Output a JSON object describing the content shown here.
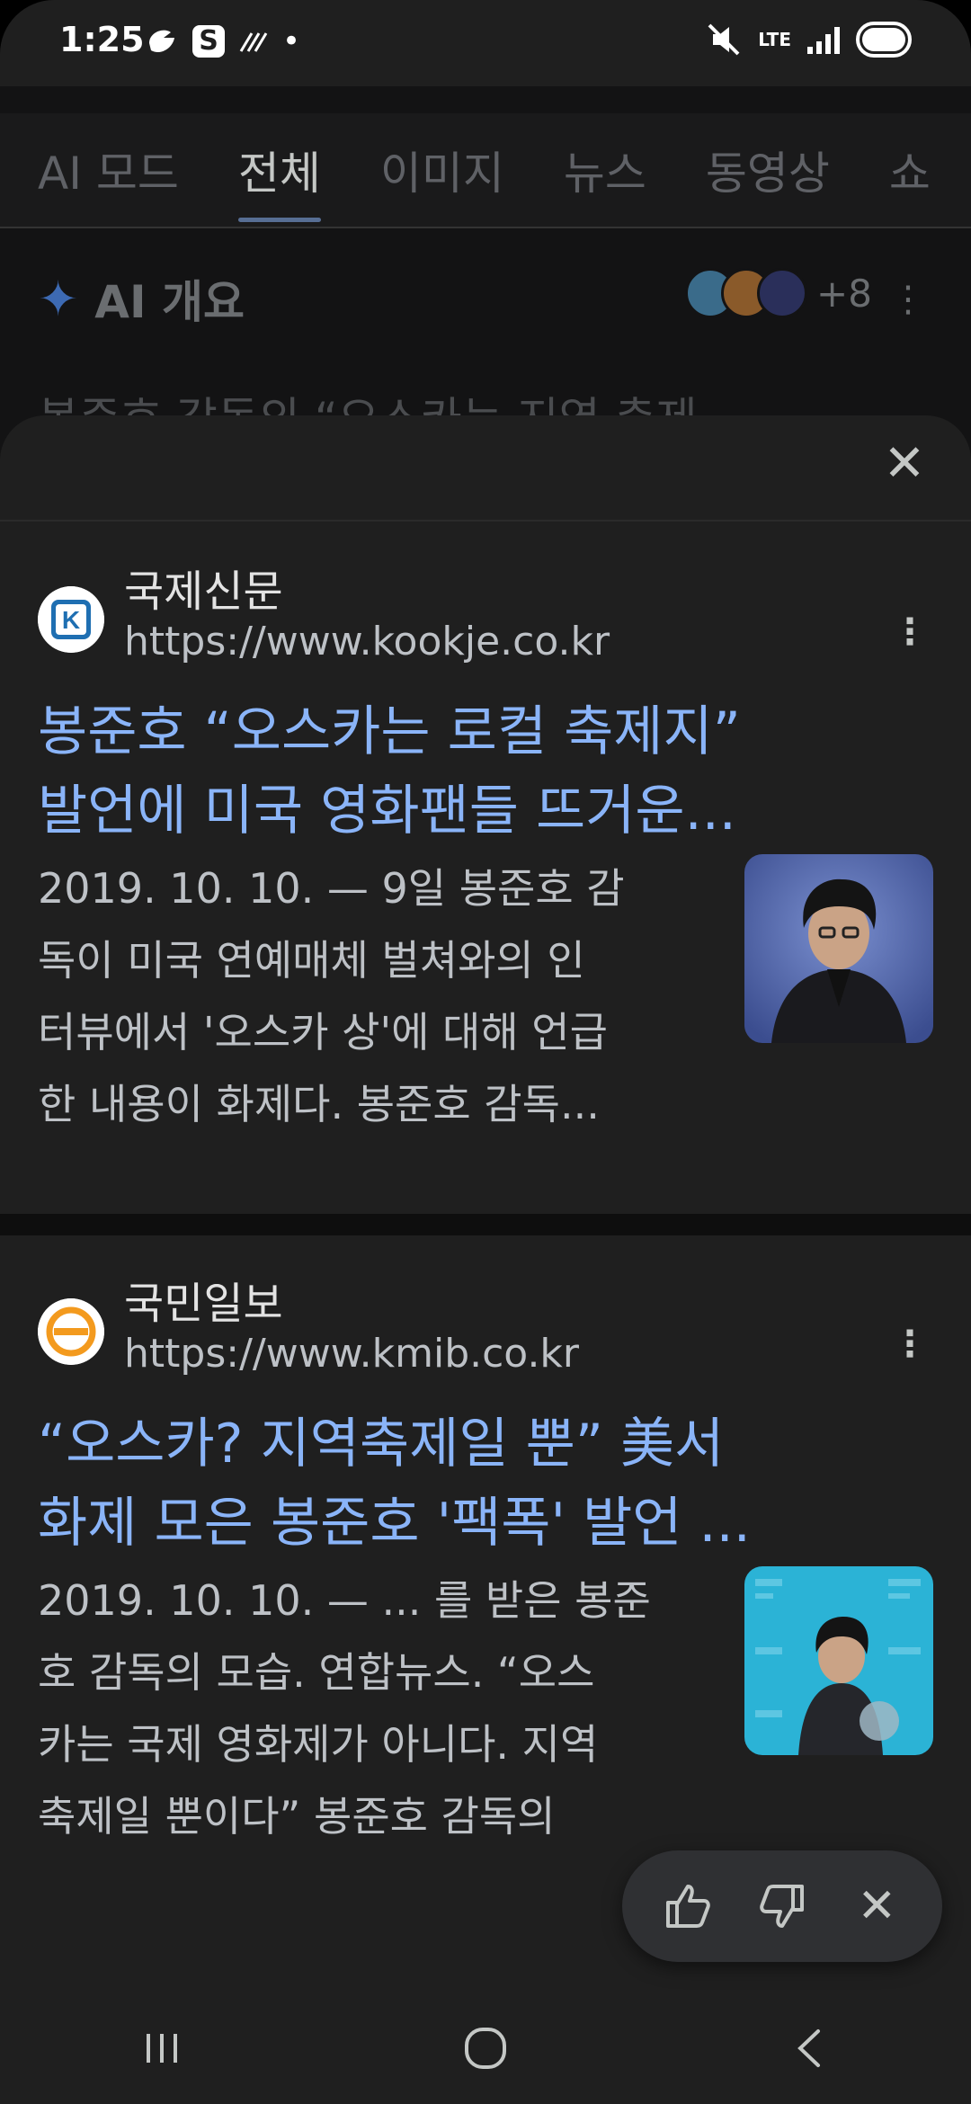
{
  "status_bar": {
    "time": "1:25",
    "network": "LTE"
  },
  "tabs": [
    {
      "label": "AI 모드"
    },
    {
      "label": "전체"
    },
    {
      "label": "이미지"
    },
    {
      "label": "뉴스"
    },
    {
      "label": "동영상"
    },
    {
      "label": "쇼"
    }
  ],
  "ai_overview": {
    "title": "AI 개요",
    "more_count": "+8",
    "peek_text": "봉준호 감독의 “오스카는 지역 축제"
  },
  "results": [
    {
      "source_name": "국제신문",
      "url": "https://www.kookje.co.kr",
      "title_lines": [
        "봉준호 “오스카는 로컬 축제지”",
        "발언에 미국 영화팬들 뜨거운..."
      ],
      "snippet_lines": [
        "2019. 10. 10. — 9일 봉준호 감",
        "독이 미국 연예매체 벌쳐와의 인",
        "터뷰에서 '오스카 상'에 대해 언급",
        "한 내용이 화제다. 봉준호 감독..."
      ],
      "favicon_letter": "K"
    },
    {
      "source_name": "국민일보",
      "url": "https://www.kmib.co.kr",
      "title_lines": [
        "“오스카? 지역축제일 뿐” 美서",
        "화제 모은 봉준호 '팩폭' 발언 ..."
      ],
      "snippet_lines": [
        "2019. 10. 10. — ... 를 받은 봉준",
        "호 감독의 모습. 연합뉴스. “오스",
        "카는 국제 영화제가 아니다. 지역",
        "축제일 뿐이다” 봉준호 감독의"
      ]
    }
  ],
  "colors": {
    "link": "#8ab4f8",
    "sheet_bg": "#1f1f1f",
    "page_bg": "#131314"
  }
}
